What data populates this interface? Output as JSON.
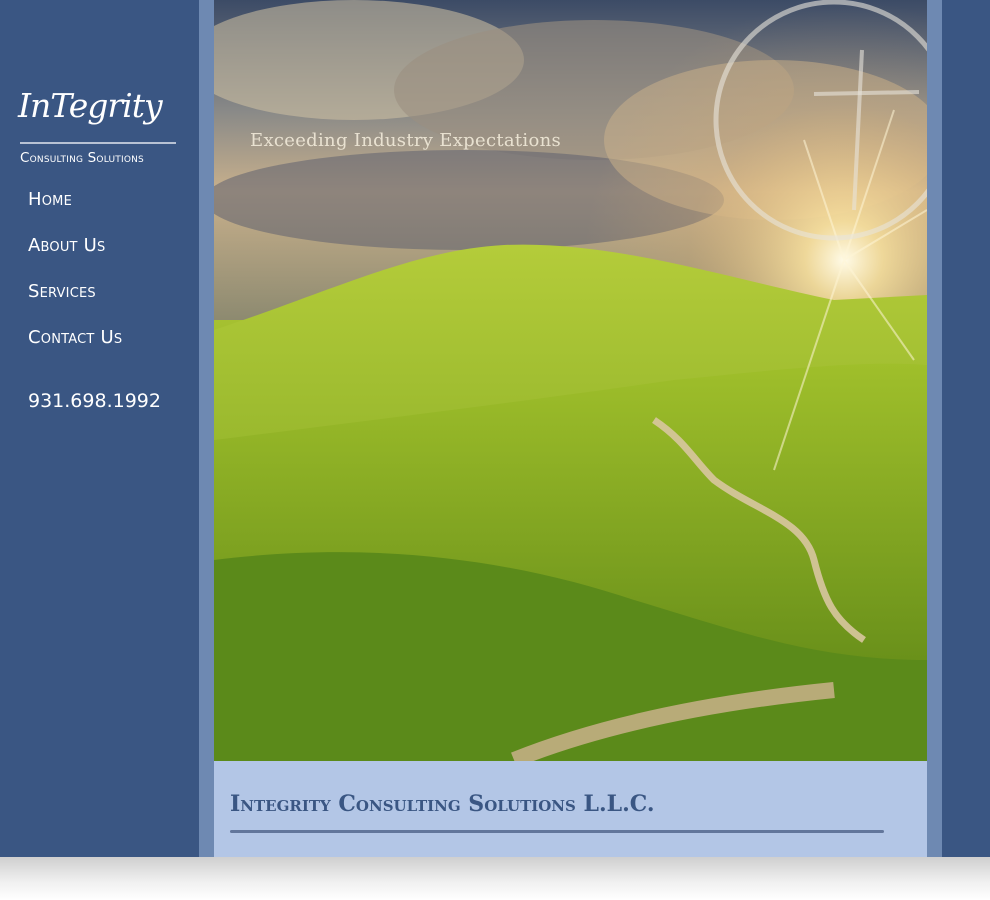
{
  "brand": {
    "logo_script": "InTegrity",
    "logo_sub": "Consulting Solutions"
  },
  "nav": {
    "items": [
      {
        "label": "Home"
      },
      {
        "label": "About Us"
      },
      {
        "label": "Services"
      },
      {
        "label": "Contact Us"
      }
    ]
  },
  "contact": {
    "phone": "931.698.1992"
  },
  "hero": {
    "tagline": "Exceeding Industry Expectations"
  },
  "content": {
    "title": "Integrity Consulting Solutions L.L.C."
  },
  "colors": {
    "sidebar": "#3a5683",
    "gutter": "#6e89b2",
    "content_bg": "#b3c6e6",
    "title": "#3a5683"
  }
}
